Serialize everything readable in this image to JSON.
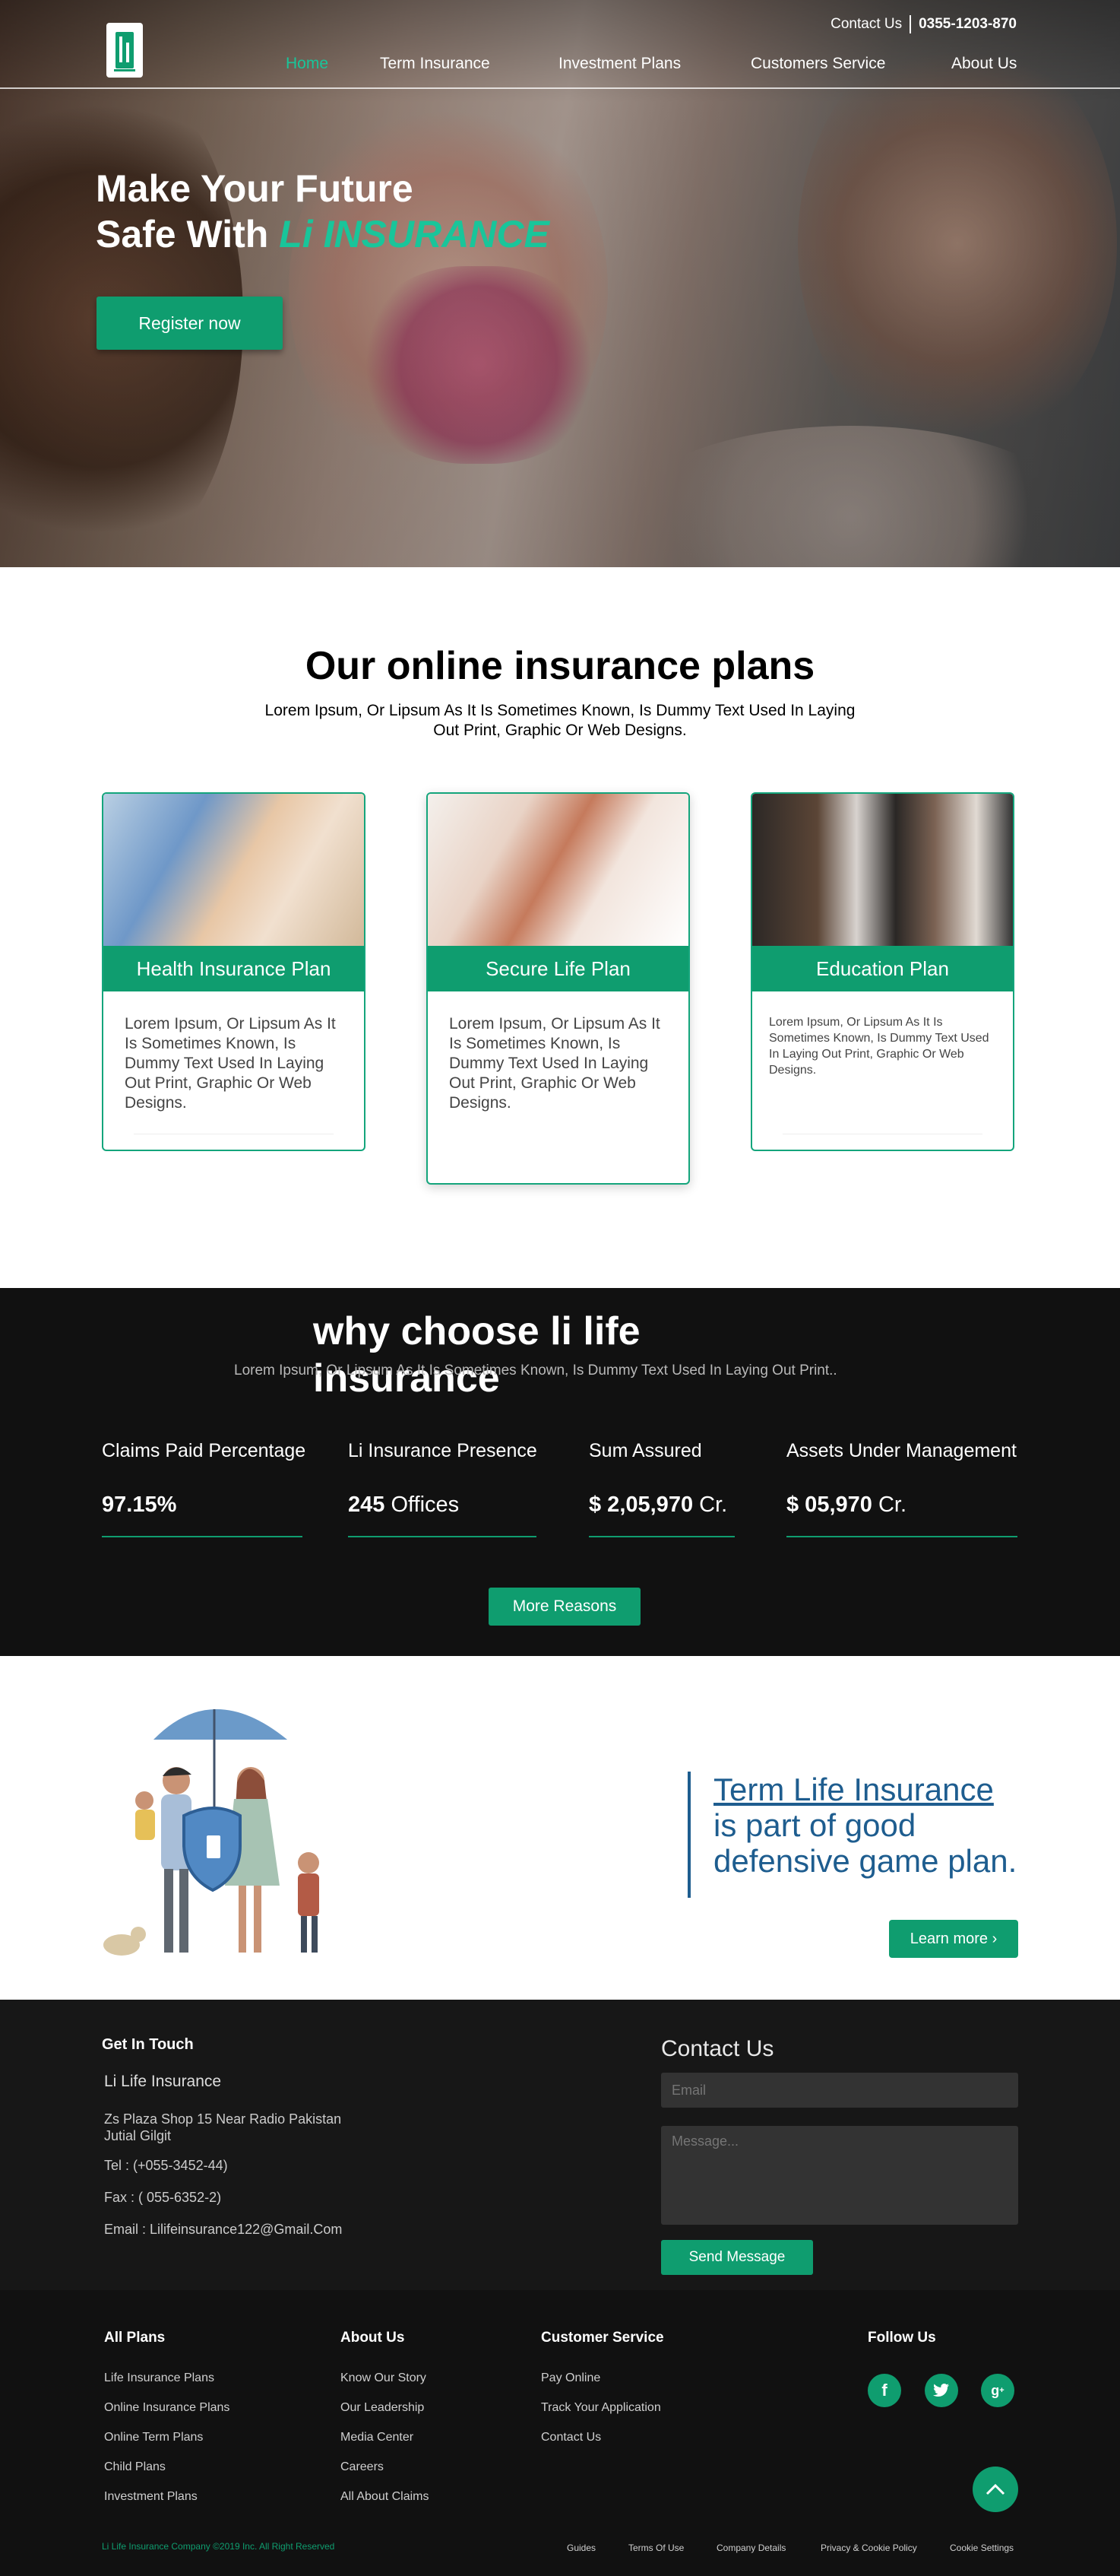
{
  "header": {
    "contact_label": "Contact Us",
    "phone": "0355-1203-870",
    "nav": [
      "Home",
      "Term Insurance",
      "Investment Plans",
      "Customers Service",
      "About Us"
    ],
    "active_nav": "Home"
  },
  "hero": {
    "line1": "Make Your Future",
    "line2_prefix": "Safe With ",
    "brand": "Li INSURANCE",
    "register_label": "Register now"
  },
  "plans": {
    "title": "Our online insurance plans",
    "subtitle": "Lorem Ipsum, Or Lipsum As It Is Sometimes Known, Is Dummy Text Used In Laying Out Print, Graphic Or Web Designs.",
    "cards": [
      {
        "title": "Health Insurance Plan",
        "text": "Lorem Ipsum, Or Lipsum As It Is Sometimes Known, Is Dummy Text Used In Laying Out Print, Graphic Or Web Designs."
      },
      {
        "title": "Secure Life Plan",
        "text": "Lorem Ipsum, Or Lipsum As It Is Sometimes Known, Is Dummy Text Used In Laying Out Print, Graphic Or Web Designs."
      },
      {
        "title": "Education Plan",
        "text": "Lorem Ipsum, Or Lipsum As It Is Sometimes Known, Is Dummy Text Used In Laying Out Print, Graphic Or Web Designs."
      }
    ]
  },
  "why": {
    "title": "why choose li life insurance",
    "subtitle": "Lorem Ipsum, Or Lipsum As It Is Sometimes Known, Is Dummy Text Used In Laying Out Print..",
    "stats": [
      {
        "label": "Claims Paid Percentage",
        "value": "97.15%",
        "unit": ""
      },
      {
        "label": "Li Insurance Presence",
        "value": "245",
        "unit": "Offices"
      },
      {
        "label": "Sum Assured",
        "value": "$ 2,05,970",
        "unit": "Cr."
      },
      {
        "label": "Assets Under Management",
        "value": "$ 05,970",
        "unit": "Cr."
      }
    ],
    "button": "More Reasons"
  },
  "term": {
    "link_text": "Term Life Insurance",
    "rest_text": " is part of good defensive game plan.",
    "button": "Learn more"
  },
  "contact": {
    "get_in_touch": "Get In Touch",
    "company": "Li Life Insurance",
    "address": "Zs Plaza Shop 15 Near Radio Pakistan Jutial Gilgit",
    "tel": "Tel : (+055-3452-44)",
    "fax": "Fax : ( 055-6352-2)",
    "email": "Email : Lilifeinsurance122@Gmail.Com",
    "form_title": "Contact Us",
    "email_placeholder": "Email",
    "message_placeholder": "Message...",
    "send_label": "Send Message"
  },
  "footer": {
    "all_plans": {
      "title": "All Plans",
      "items": [
        "Life Insurance Plans",
        "Online Insurance Plans",
        "Online Term Plans",
        "Child Plans",
        "Investment Plans"
      ]
    },
    "about": {
      "title": "About Us",
      "items": [
        "Know Our Story",
        "Our Leadership",
        "Media Center",
        "Careers",
        "All About Claims"
      ]
    },
    "service": {
      "title": "Customer Service",
      "items": [
        "Pay Online",
        "Track Your Application",
        "Contact Us"
      ]
    },
    "follow": {
      "title": "Follow Us",
      "icons": [
        "facebook-icon",
        "twitter-icon",
        "google-plus-icon"
      ]
    },
    "copyright": "Li Life Insurance Company ©2019 Inc. All Right Reserved",
    "links": [
      "Guides",
      "Terms Of Use",
      "Company Details",
      "Privacy & Cookie Policy",
      "Cookie Settings"
    ]
  },
  "colors": {
    "accent": "#0f9d6f",
    "brand_text": "#19c59a",
    "term_blue": "#1e5d8f",
    "dark_bg": "#111111"
  }
}
